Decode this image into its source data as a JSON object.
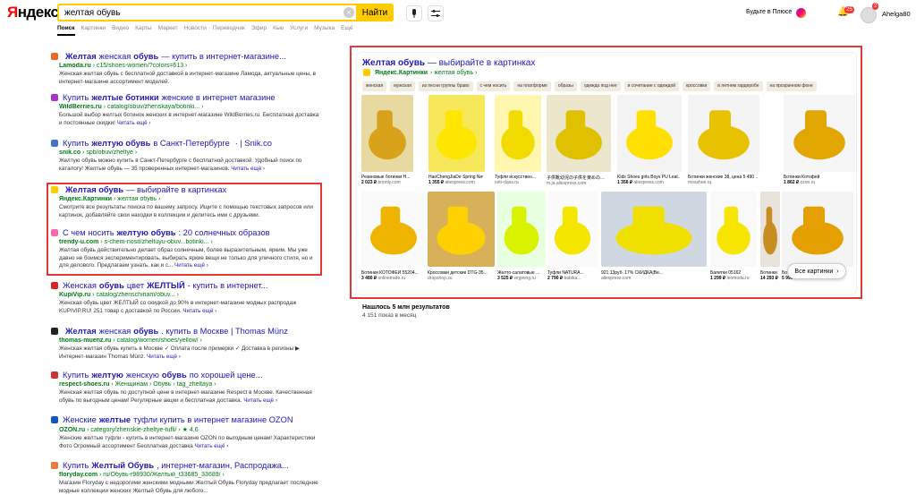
{
  "logo": {
    "y": "Я",
    "rest": "ндекс"
  },
  "search": {
    "value": "желтая обувь",
    "button": "Найти",
    "clear": "×"
  },
  "header": {
    "plus_label": "Будьте в Плюсе",
    "bell_count": "25",
    "avatar_count": "2",
    "username": "Ahelga80"
  },
  "tabs": [
    "Поиск",
    "Картинки",
    "Видео",
    "Карты",
    "Маркет",
    "Новости",
    "Переводчик",
    "Эфир",
    "Кью",
    "Услуги",
    "Музыка",
    "Ещё"
  ],
  "results": [
    {
      "favicon": "#e62",
      "title_pre": "",
      "title_bold": "Желтая",
      "title_post": " женская ",
      "title_bold2": "обувь",
      "title_post2": " — купить в интернет-магазине...",
      "site": "Lamoda.ru",
      "path": " › c15/shoes-women/?colors=613 ›",
      "snippet": "Женская желтая обувь с бесплатной доставкой в интернет-магазине Ламода, актуальные цены, в интернет-магазине ассортимент моделей.",
      "more": ""
    },
    {
      "favicon": "#a3c",
      "title_pre": "Купить ",
      "title_bold": "желтые ботинки",
      "title_post": " женские в интернет магазине",
      "title_bold2": "",
      "title_post2": "",
      "site": "WildBerries.ru",
      "path": " › catalog/obuv/zhenskaya/botinki... ›",
      "snippet": "Большой выбор желтых ботинок женских в интернет-магазине WildBerries.ru. Бесплатная доставка и постоянные скидки!",
      "more": "Читать ещё ›"
    },
    {
      "favicon": "#47c",
      "title_pre": "Купить ",
      "title_bold": "желтую обувь",
      "title_post": " в Санкт-Петербурге",
      "title_bold2": "",
      "title_post2": " · | Snik.co",
      "site": "snik.co",
      "path": " › spb/obuv/zheltye ›",
      "snippet": "Желтую обувь можно купить в Санкт-Петербурге с бесплатной доставкой. Удобный поиск по каталогу! Желтые обувь — 35 проверенных интернет-магазинов.",
      "more": "Читать ещё ›"
    },
    {
      "favicon": "#fc0",
      "title_pre": "",
      "title_bold": "Желтая обувь",
      "title_post": " — выбирайте в картинках",
      "title_bold2": "",
      "title_post2": "",
      "site": "Яндекс.Картинки",
      "path": " › желтая обувь ›",
      "snippet": "Смотрите все результаты поиска по вашему запросу. Ищите с помощью текстовых запросов или картинок, добавляйте свои находки в коллекции и делитесь ими с друзьями.",
      "more": ""
    },
    {
      "favicon": "#f6a",
      "title_pre": "С чем носить ",
      "title_bold": "желтую обувь",
      "title_post": ": 20 солнечных образов",
      "title_bold2": "",
      "title_post2": "",
      "site": "trendy-u.com",
      "path": " › s-chem-nosit/zheltuyu-obuv...botinki... ›",
      "snippet": "Желтая обувь действительно делает образ солнечным, более выразительным, ярким. Мы уже давно не боимся экспериментировать, выбирать яркие вещи не только для уличного стиля, но и для делового. Предлагаем узнать, как и с...",
      "more": "Читать ещё ›"
    },
    {
      "favicon": "#d22",
      "title_pre": "Женская ",
      "title_bold": "обувь",
      "title_post": " цвет ",
      "title_bold2": "ЖЕЛТЫЙ",
      "title_post2": " - купить в интернет...",
      "site": "KupiVip.ru",
      "path": " › catalog/zhenschinam/obuv... ›",
      "snippet": "Женская обувь цвет ЖЕЛТЫЙ со скидкой до 90% в интернет-магазине модных распродаж KUPIVIP.RU! 251 товар с доставкой по России.",
      "more": "Читать ещё ›"
    },
    {
      "favicon": "#222",
      "title_pre": "",
      "title_bold": "Желтая",
      "title_post": " женская ",
      "title_bold2": "обувь",
      "title_post2": ". купить в Москве | Thomas Münz",
      "site": "thomas-muenz.ru",
      "path": " › catalog/women/shoes/yellow/ ›",
      "snippet": "Женская желтая обувь купить в Москве ✓ Оплата после примерки ✓ Доставка в регионы ▶ Интернет-магазин Thomas Münz.",
      "more": "Читать ещё ›"
    },
    {
      "favicon": "#c33",
      "title_pre": "Купить ",
      "title_bold": "желтую",
      "title_post": " женскую ",
      "title_bold2": "обувь",
      "title_post2": " по хорошей цене...",
      "site": "respect-shoes.ru",
      "path": " › Женщинам › Обувь › tag_zheltaya ›",
      "snippet": "Женская желтая обувь по доступной цене в интернет-магазине Respect в Москве. Качественная обувь по выгодным ценам! Регулярные акции и бесплатная доставка.",
      "more": "Читать ещё ›"
    },
    {
      "favicon": "#15c",
      "title_pre": "Женские ",
      "title_bold": "желтые",
      "title_post": " туфли купить в интернет магазине OZON",
      "title_bold2": "",
      "title_post2": "",
      "site": "OZON.ru",
      "path": " › category/zhenskie-zheltye-tufli/ › ★ 4,6",
      "snippet": "Женские желтые туфли - купить в интернет-магазине OZON по выгодным ценам! Характеристики Фото Огромный ассортимент Бесплатная доставка",
      "more": "Читать ещё ›"
    },
    {
      "favicon": "#e74",
      "title_pre": "Купить ",
      "title_bold": "Желтый Обувь",
      "title_post": ", интернет-магазин, Распродажа...",
      "title_bold2": "",
      "title_post2": "",
      "site": "floryday.com",
      "path": " › ru/Обувь-r98930/Желтый_t33685_33689/ ›",
      "snippet": "Магазин Floryday с недорогими женскими модными Желтый Обувь Floryday предлагает последние модные коллекции женских Желтый Обувь для любого...",
      "more": ""
    }
  ],
  "panel": {
    "title_bold": "Желтая обувь",
    "title_rest": " — выбирайте в картинках",
    "source": "Яндекс.Картинки",
    "source_path": " › желтая обувь ›",
    "chips": [
      "женская",
      "мужская",
      "из песни группы браво",
      "с чем носить",
      "на платформе",
      "образы",
      "одежда под нее",
      "и сочетание с одеждой",
      "кроссовки",
      "в летнем гардеробе",
      "на прозрачном фоне"
    ],
    "row1": [
      {
        "cap": "Резиновые ботинки Н...",
        "price": "2 023 ₽",
        "dom": "brionly.com"
      },
      {
        "cap": "HaoChengJiaDe Spring New Ki...",
        "price": "1 355 ₽",
        "dom": "aliexpress.com"
      },
      {
        "cap": "Туфли искусствен...",
        "price": "",
        "dom": "ceti-class.ru"
      },
      {
        "cap": "子供靴幼児の子供を楽めの…",
        "price": "",
        "dom": "m.ja.aliexpress.com"
      },
      {
        "cap": "Kids Shoes girls Boys PU Leat...",
        "price": "1 356 ₽",
        "dom": "aliexpress.com"
      },
      {
        "cap": "Ботинки женские 38, цена 5 490 ...",
        "price": "",
        "dom": "mosshoe.ru"
      },
      {
        "cap": "Ботинки Котофей",
        "price": "1 862 ₽",
        "dom": "ozon.ru"
      }
    ],
    "row2": [
      {
        "cap": "Ботинки КОТОФЕЙ 55204...",
        "price": "3 480 ₽",
        "dom": "onlinetrade.ru"
      },
      {
        "cap": "Кроссовки детские DTG-35...",
        "price": "",
        "dom": "dropshop.su"
      },
      {
        "cap": "Желто-салатовые ...",
        "price": "3 525 ₽",
        "dom": "virgining.ru"
      },
      {
        "cap": "Туфли NATURA...",
        "price": "2 790 ₽",
        "dom": "babika..."
      },
      {
        "cap": "921.13руб. 17% СКИДКА|Ве...",
        "price": "",
        "dom": "aliexpress.com"
      },
      {
        "cap": "Балетки 05162",
        "price": "1 299 ₽",
        "dom": "leomoda.ru"
      },
      {
        "cap": "Ботинки Timberland",
        "price": "14 293 ₽",
        "dom": "ozon.ru"
      },
      {
        "cap": "Ботинки Котофей",
        "price": "5 996 ₽",
        "dom": "onlinetrade.ru"
      }
    ],
    "all_images": "Все картинки"
  },
  "stats": {
    "found": "Нашлось 5 млн результатов",
    "shows": "4 151 показ в месяц"
  }
}
